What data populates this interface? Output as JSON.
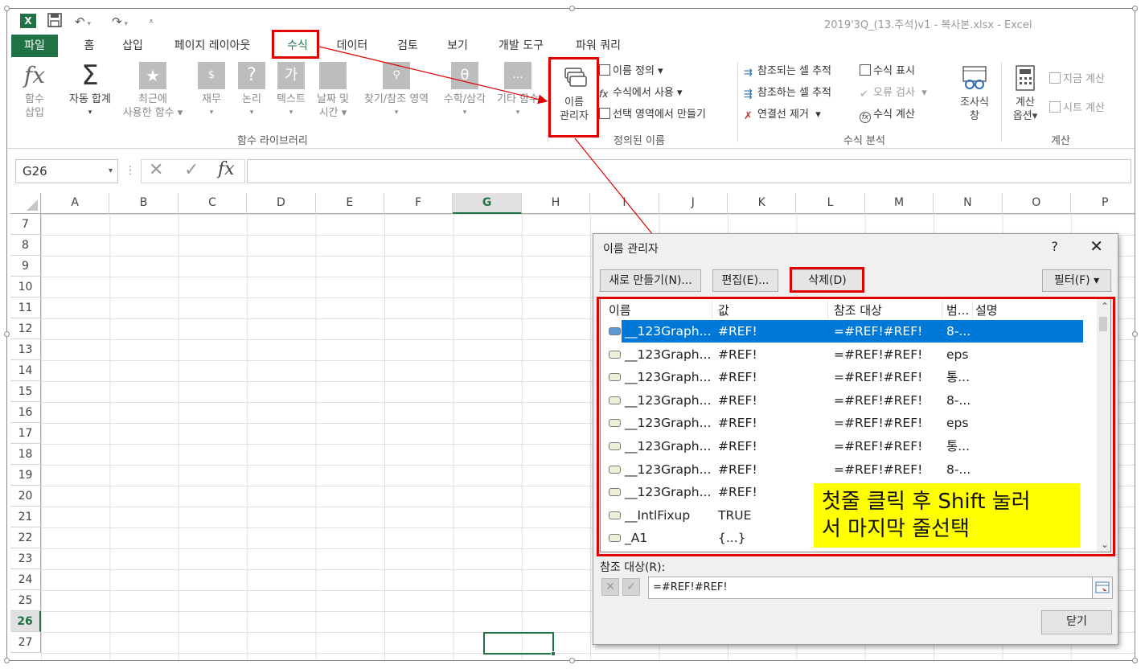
{
  "window": {
    "app_logo": "X",
    "title": "2019'3Q_(13.주석)v1 - 복사본.xlsx - Excel",
    "qat": {
      "save_icon": "save-icon",
      "undo_icon": "undo-icon",
      "redo_icon": "redo-icon",
      "customize_icon": "customize-icon"
    }
  },
  "tabs": [
    "파일",
    "홈",
    "삽입",
    "페이지 레이아웃",
    "수식",
    "데이터",
    "검토",
    "보기",
    "개발 도구",
    "파워 쿼리"
  ],
  "ribbon": {
    "function_library": {
      "insert_function": [
        "함수",
        "삽입"
      ],
      "autosum": "자동 합계",
      "recent": [
        "최근에",
        "사용한 함수"
      ],
      "financial": "재무",
      "logical": "논리",
      "text": "텍스트",
      "datetime": [
        "날짜 및",
        "시간"
      ],
      "lookup": "찾기/참조 영역",
      "math": "수학/삼각",
      "more": "기타 함수",
      "group_label": "함수 라이브러리"
    },
    "defined_names": {
      "name_manager": [
        "이름",
        "관리자"
      ],
      "define_name": "이름 정의",
      "use_in_formula": "수식에서 사용",
      "create_from_selection": "선택 영역에서 만들기",
      "group_label": "정의된 이름"
    },
    "formula_auditing": {
      "trace_precedents": "참조되는 셀 추적",
      "trace_dependents": "참조하는 셀 추적",
      "remove_arrows": "연결선 제거",
      "show_formulas": "수식 표시",
      "error_checking": "오류 검사",
      "evaluate_formula": "수식 계산",
      "watch_window": [
        "조사식",
        "창"
      ],
      "group_label": "수식 분석"
    },
    "calculation": {
      "calc_options": [
        "계산",
        "옵션"
      ],
      "calc_now": "지금 계산",
      "calc_sheet": "시트 계산",
      "group_label": "계산"
    }
  },
  "formula_bar": {
    "name_box": "G26",
    "cancel": "✕",
    "enter": "✓",
    "fx": "fx",
    "value": ""
  },
  "grid": {
    "columns": [
      "A",
      "B",
      "C",
      "D",
      "E",
      "F",
      "G",
      "H",
      "I",
      "J",
      "K",
      "L",
      "M",
      "N",
      "O",
      "P"
    ],
    "rows": [
      "7",
      "8",
      "9",
      "10",
      "11",
      "12",
      "13",
      "14",
      "15",
      "16",
      "17",
      "18",
      "19",
      "20",
      "21",
      "22",
      "23",
      "24",
      "25",
      "26",
      "27"
    ],
    "active_column": "G",
    "active_row": "26"
  },
  "dialog": {
    "title": "이름 관리자",
    "help": "?",
    "close": "✕",
    "new_button": "새로 만들기(N)...",
    "edit_button": "편집(E)...",
    "delete_button": "삭제(D)",
    "filter_button": "필터(F) ▾",
    "columns": [
      "이름",
      "값",
      "참조 대상",
      "범...",
      "설명"
    ],
    "rows": [
      {
        "name": "__123Graph...",
        "value": "#REF!",
        "ref": "=#REF!#REF!",
        "scope": "8-..."
      },
      {
        "name": "__123Graph...",
        "value": "#REF!",
        "ref": "=#REF!#REF!",
        "scope": "eps"
      },
      {
        "name": "__123Graph...",
        "value": "#REF!",
        "ref": "=#REF!#REF!",
        "scope": "통..."
      },
      {
        "name": "__123Graph...",
        "value": "#REF!",
        "ref": "=#REF!#REF!",
        "scope": "8-..."
      },
      {
        "name": "__123Graph...",
        "value": "#REF!",
        "ref": "=#REF!#REF!",
        "scope": "eps"
      },
      {
        "name": "__123Graph...",
        "value": "#REF!",
        "ref": "=#REF!#REF!",
        "scope": "통..."
      },
      {
        "name": "__123Graph...",
        "value": "#REF!",
        "ref": "=#REF!#REF!",
        "scope": "8-..."
      },
      {
        "name": "__123Graph...",
        "value": "#REF!",
        "ref": "",
        "scope": ""
      },
      {
        "name": "__IntlFixup",
        "value": "TRUE",
        "ref": "",
        "scope": ""
      },
      {
        "name": "_A1",
        "value": "{...}",
        "ref": "",
        "scope": ""
      }
    ],
    "note": [
      "첫줄 클릭 후 Shift 눌러",
      "서 마지막 줄선택"
    ],
    "ref_label": "참조 대상(R):",
    "ref_value": "=#REF!#REF!",
    "close_button": "닫기"
  },
  "colors": {
    "excel_green": "#217346",
    "annotation_red": "#e00000",
    "highlight_yellow": "#ffff00",
    "selection_blue": "#0078d7"
  }
}
